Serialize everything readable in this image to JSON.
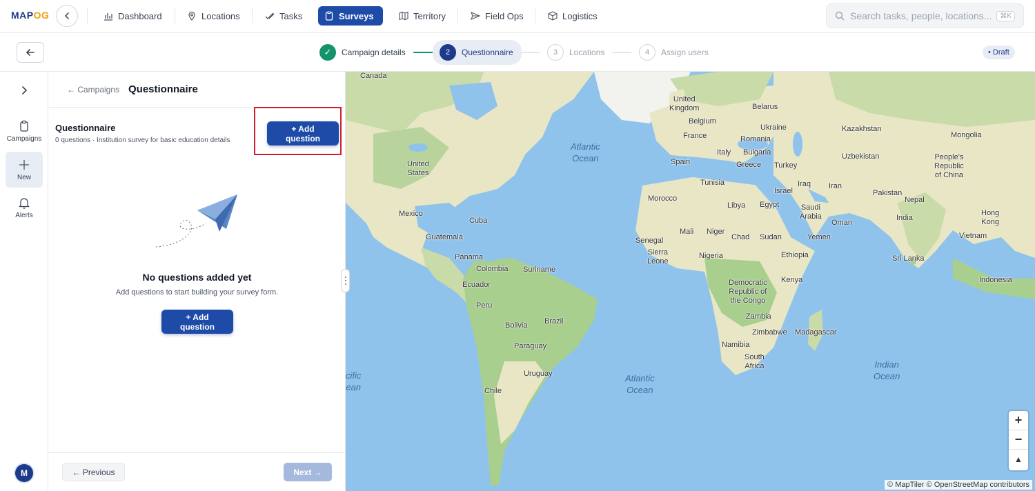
{
  "brand": {
    "logo_text_a": "MAP",
    "logo_text_b": "OG"
  },
  "nav": {
    "items": [
      {
        "label": "Dashboard",
        "icon": "bar-chart-icon"
      },
      {
        "label": "Locations",
        "icon": "map-pin-icon"
      },
      {
        "label": "Tasks",
        "icon": "check-icon"
      },
      {
        "label": "Surveys",
        "icon": "clipboard-icon",
        "active": true
      },
      {
        "label": "Territory",
        "icon": "map-icon"
      },
      {
        "label": "Field Ops",
        "icon": "send-icon"
      },
      {
        "label": "Logistics",
        "icon": "box-icon"
      }
    ],
    "search_placeholder": "Search tasks, people, locations...",
    "search_shortcut": "⌘K"
  },
  "stepper": {
    "steps": [
      {
        "number": "✓",
        "label": "Campaign details",
        "state": "done"
      },
      {
        "number": "2",
        "label": "Questionnaire",
        "state": "current"
      },
      {
        "number": "3",
        "label": "Locations",
        "state": "upcoming"
      },
      {
        "number": "4",
        "label": "Assign users",
        "state": "upcoming"
      }
    ],
    "status_badge": "• Draft"
  },
  "rail": {
    "items": [
      {
        "label": "Campaigns",
        "icon": "clipboard-icon"
      },
      {
        "label": "New",
        "icon": "plus-icon",
        "active": true
      },
      {
        "label": "Alerts",
        "icon": "bell-icon"
      }
    ],
    "avatar_initial": "M"
  },
  "panel": {
    "breadcrumb_link": "← Campaigns",
    "title": "Questionnaire",
    "section_title": "Questionnaire",
    "section_subtitle": "0 questions · Institution survey for basic education details",
    "add_question_label": "+ Add question",
    "empty_title": "No questions added yet",
    "empty_subtitle": "Add questions to start building your survey form.",
    "empty_button_label": "+ Add question",
    "prev_label": "← Previous",
    "next_label": "Next →"
  },
  "map": {
    "labels": [
      {
        "text": "Canada",
        "kind": "country"
      },
      {
        "text": "United\nKingdom",
        "kind": "country"
      },
      {
        "text": "Belarus",
        "kind": "country"
      },
      {
        "text": "Kazakhstan",
        "kind": "country"
      },
      {
        "text": "Mongolia",
        "kind": "country"
      },
      {
        "text": "Belgium",
        "kind": "country"
      },
      {
        "text": "Ukraine",
        "kind": "country"
      },
      {
        "text": "France",
        "kind": "country"
      },
      {
        "text": "Romania",
        "kind": "country"
      },
      {
        "text": "Uzbekistan",
        "kind": "country"
      },
      {
        "text": "People's\nRepublic\nof China",
        "kind": "country"
      },
      {
        "text": "Italy",
        "kind": "country"
      },
      {
        "text": "Bulgaria",
        "kind": "country"
      },
      {
        "text": "Spain",
        "kind": "country"
      },
      {
        "text": "Greece",
        "kind": "country"
      },
      {
        "text": "Turkey",
        "kind": "country"
      },
      {
        "text": "United\nStates",
        "kind": "country"
      },
      {
        "text": "Tunisia",
        "kind": "country"
      },
      {
        "text": "Iraq",
        "kind": "country"
      },
      {
        "text": "Iran",
        "kind": "country"
      },
      {
        "text": "Israel",
        "kind": "country"
      },
      {
        "text": "Pakistan",
        "kind": "country"
      },
      {
        "text": "Morocco",
        "kind": "country"
      },
      {
        "text": "Libya",
        "kind": "country"
      },
      {
        "text": "Egypt",
        "kind": "country"
      },
      {
        "text": "Saudi\nArabia",
        "kind": "country"
      },
      {
        "text": "Nepal",
        "kind": "country"
      },
      {
        "text": "Mexico",
        "kind": "country"
      },
      {
        "text": "Oman",
        "kind": "country"
      },
      {
        "text": "India",
        "kind": "country"
      },
      {
        "text": "Hong\nKong",
        "kind": "country"
      },
      {
        "text": "Cuba",
        "kind": "country"
      },
      {
        "text": "Mali",
        "kind": "country"
      },
      {
        "text": "Niger",
        "kind": "country"
      },
      {
        "text": "Chad",
        "kind": "country"
      },
      {
        "text": "Sudan",
        "kind": "country"
      },
      {
        "text": "Yemen",
        "kind": "country"
      },
      {
        "text": "Vietnam",
        "kind": "country"
      },
      {
        "text": "Guatemala",
        "kind": "country"
      },
      {
        "text": "Senegal",
        "kind": "country"
      },
      {
        "text": "Sierra\nLeone",
        "kind": "country"
      },
      {
        "text": "Nigeria",
        "kind": "country"
      },
      {
        "text": "Ethiopia",
        "kind": "country"
      },
      {
        "text": "Panama",
        "kind": "country"
      },
      {
        "text": "Sri Lanka",
        "kind": "country"
      },
      {
        "text": "Colombia",
        "kind": "country"
      },
      {
        "text": "Suriname",
        "kind": "country"
      },
      {
        "text": "Kenya",
        "kind": "country"
      },
      {
        "text": "Indonesia",
        "kind": "country"
      },
      {
        "text": "Ecuador",
        "kind": "country"
      },
      {
        "text": "Democratic\nRepublic of\nthe Congo",
        "kind": "country"
      },
      {
        "text": "Peru",
        "kind": "country"
      },
      {
        "text": "Brazil",
        "kind": "country"
      },
      {
        "text": "Bolivia",
        "kind": "country"
      },
      {
        "text": "Zambia",
        "kind": "country"
      },
      {
        "text": "Zimbabwe",
        "kind": "country"
      },
      {
        "text": "Madagascar",
        "kind": "country"
      },
      {
        "text": "Paraguay",
        "kind": "country"
      },
      {
        "text": "Namibia",
        "kind": "country"
      },
      {
        "text": "Uruguay",
        "kind": "country"
      },
      {
        "text": "South\nAfrica",
        "kind": "country"
      },
      {
        "text": "Chile",
        "kind": "country"
      },
      {
        "text": "Atlantic\nOcean",
        "kind": "ocean"
      },
      {
        "text": "Atlantic\nOcean",
        "kind": "ocean"
      },
      {
        "text": "Indian\nOcean",
        "kind": "ocean"
      },
      {
        "text": "cific\nean",
        "kind": "ocean"
      }
    ],
    "zoom_in": "+",
    "zoom_out": "−",
    "compass": "▲",
    "attribution": "© MapTiler © OpenStreetMap contributors"
  }
}
